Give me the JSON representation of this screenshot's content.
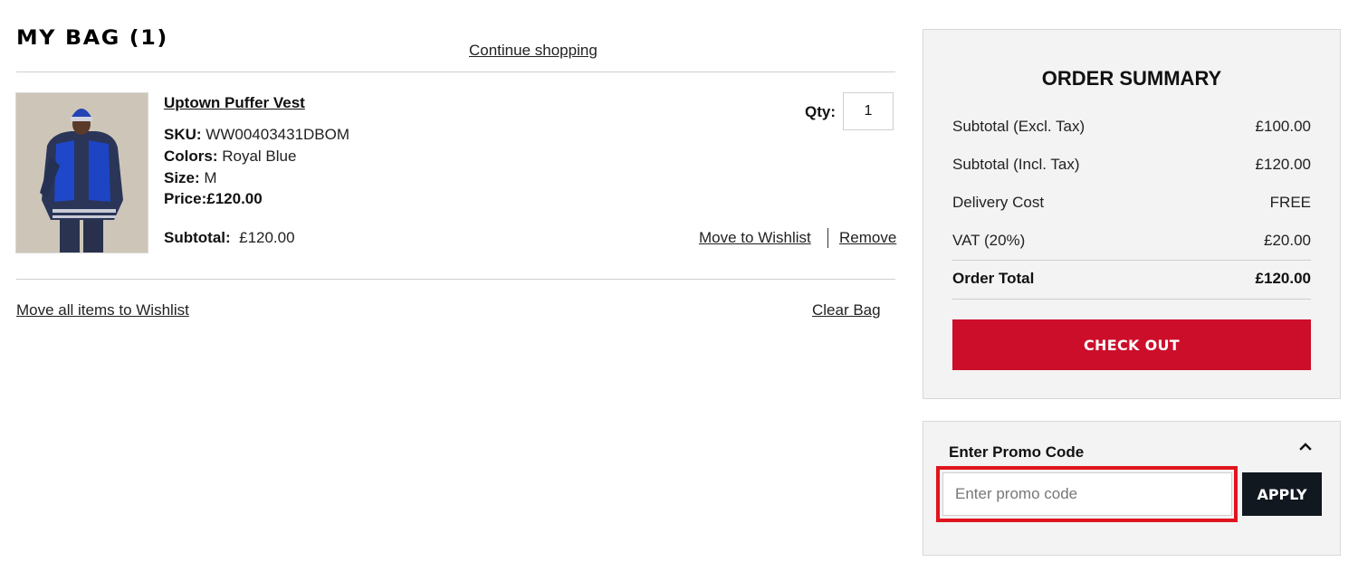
{
  "bag": {
    "title": "MY BAG (1)",
    "continue_shopping": "Continue shopping",
    "items": [
      {
        "name": "Uptown Puffer Vest",
        "sku_label": "SKU:",
        "sku": "WW00403431DBOM",
        "colors_label": "Colors:",
        "colors": "Royal Blue",
        "size_label": "Size:",
        "size": "M",
        "price_label": "Price:",
        "price": "£120.00",
        "subtotal_label": "Subtotal:",
        "subtotal": "£120.00",
        "qty_label": "Qty:",
        "qty": "1",
        "move_to_wishlist": "Move to Wishlist",
        "remove": "Remove",
        "image_icon": "product-photo"
      }
    ],
    "move_all_to_wishlist": "Move all items to Wishlist",
    "clear_bag": "Clear Bag"
  },
  "summary": {
    "title": "ORDER SUMMARY",
    "rows": [
      {
        "label": "Subtotal (Excl. Tax)",
        "value": "£100.00"
      },
      {
        "label": "Subtotal (Incl. Tax)",
        "value": "£120.00"
      },
      {
        "label": "Delivery Cost",
        "value": "FREE"
      },
      {
        "label": "VAT (20%)",
        "value": "£20.00"
      }
    ],
    "total_label": "Order Total",
    "total_value": "£120.00",
    "checkout": "CHECK OUT"
  },
  "promo": {
    "title": "Enter Promo Code",
    "placeholder": "Enter promo code",
    "value": "",
    "apply": "APPLY",
    "toggle_icon": "chevron-up-icon"
  },
  "colors": {
    "checkout_red": "#cc0e2a",
    "apply_dark": "#111820",
    "highlight_red": "#e0141e",
    "panel_bg": "#f3f3f3"
  }
}
